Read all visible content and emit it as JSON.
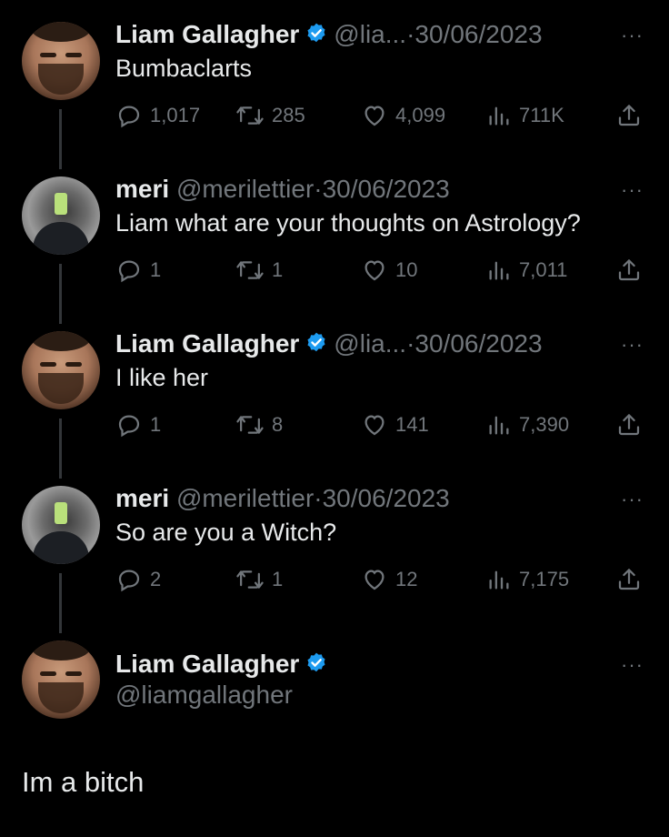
{
  "tweets": [
    {
      "name": "Liam Gallagher",
      "handle": "@lia...",
      "date": "30/06/2023",
      "text": "Bumbaclarts",
      "replies": "1,017",
      "retweets": "285",
      "likes": "4,099",
      "views": "711K"
    },
    {
      "name": "meri",
      "handle": "@merilettier",
      "date": "30/06/2023",
      "text": "Liam what are your thoughts on Astrology?",
      "replies": "1",
      "retweets": "1",
      "likes": "10",
      "views": "7,011"
    },
    {
      "name": "Liam Gallagher",
      "handle": "@lia...",
      "date": "30/06/2023",
      "text": "I like her",
      "replies": "1",
      "retweets": "8",
      "likes": "141",
      "views": "7,390"
    },
    {
      "name": "meri",
      "handle": "@merilettier",
      "date": "30/06/2023",
      "text": "So are you a Witch?",
      "replies": "2",
      "retweets": "1",
      "likes": "12",
      "views": "7,175"
    }
  ],
  "main": {
    "name": "Liam Gallagher",
    "handle": "@liamgallagher",
    "text": "Im a bitch"
  },
  "separator": "·",
  "more_label": "···",
  "colors": {
    "background": "#000000",
    "text": "#e7e9ea",
    "muted": "#71767b",
    "verified": "#1d9bf0",
    "thread_line": "#333639"
  },
  "icons": [
    "reply-icon",
    "retweet-icon",
    "like-icon",
    "views-icon",
    "share-icon",
    "verified-badge-icon",
    "more-icon"
  ]
}
